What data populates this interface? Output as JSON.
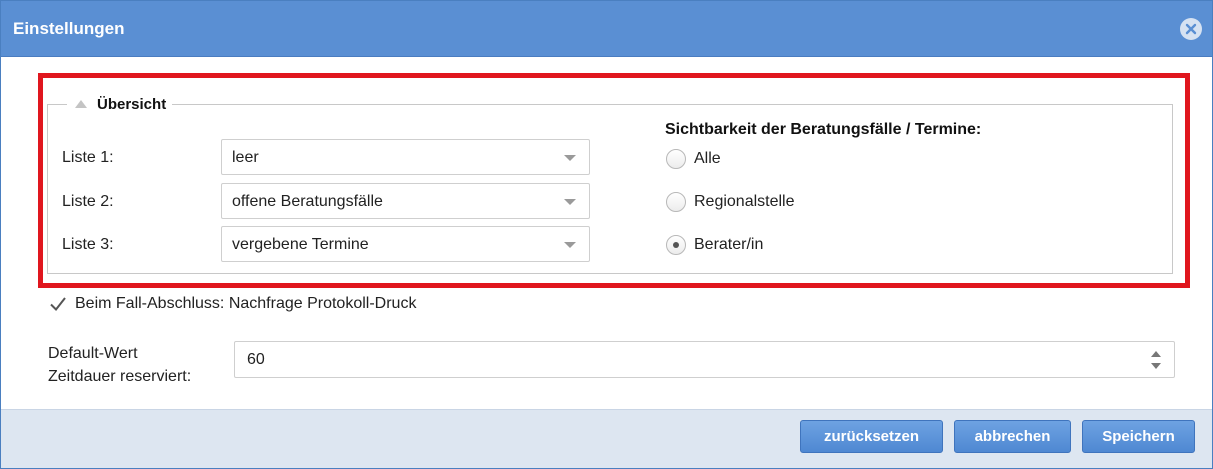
{
  "dialog": {
    "title": "Einstellungen",
    "close_icon": "close-circle-icon"
  },
  "overview": {
    "legend": "Übersicht",
    "collapse_icon": "triangle-up-icon",
    "lists": [
      {
        "label": "Liste 1:",
        "value": "leer"
      },
      {
        "label": "Liste 2:",
        "value": "offene Beratungsfälle"
      },
      {
        "label": "Liste 3:",
        "value": "vergebene Termine"
      }
    ],
    "visibility": {
      "heading": "Sichtbarkeit der Beratungsfälle / Termine:",
      "options": [
        {
          "label": "Alle",
          "checked": false
        },
        {
          "label": "Regionalstelle",
          "checked": false
        },
        {
          "label": "Berater/in",
          "checked": true
        }
      ]
    }
  },
  "protocol_checkbox": {
    "label": "Beim Fall-Abschluss: Nachfrage Protokoll-Druck",
    "checked": true
  },
  "default_duration": {
    "label_line1": "Default-Wert",
    "label_line2": "Zeitdauer reserviert:",
    "value": "60"
  },
  "buttons": {
    "reset": "zurücksetzen",
    "cancel": "abbrechen",
    "save": "Speichern"
  },
  "colors": {
    "titlebar": "#5a8fd3",
    "highlight": "#e0161e",
    "button": "#5a8fd3",
    "footer": "#dde6f1"
  }
}
